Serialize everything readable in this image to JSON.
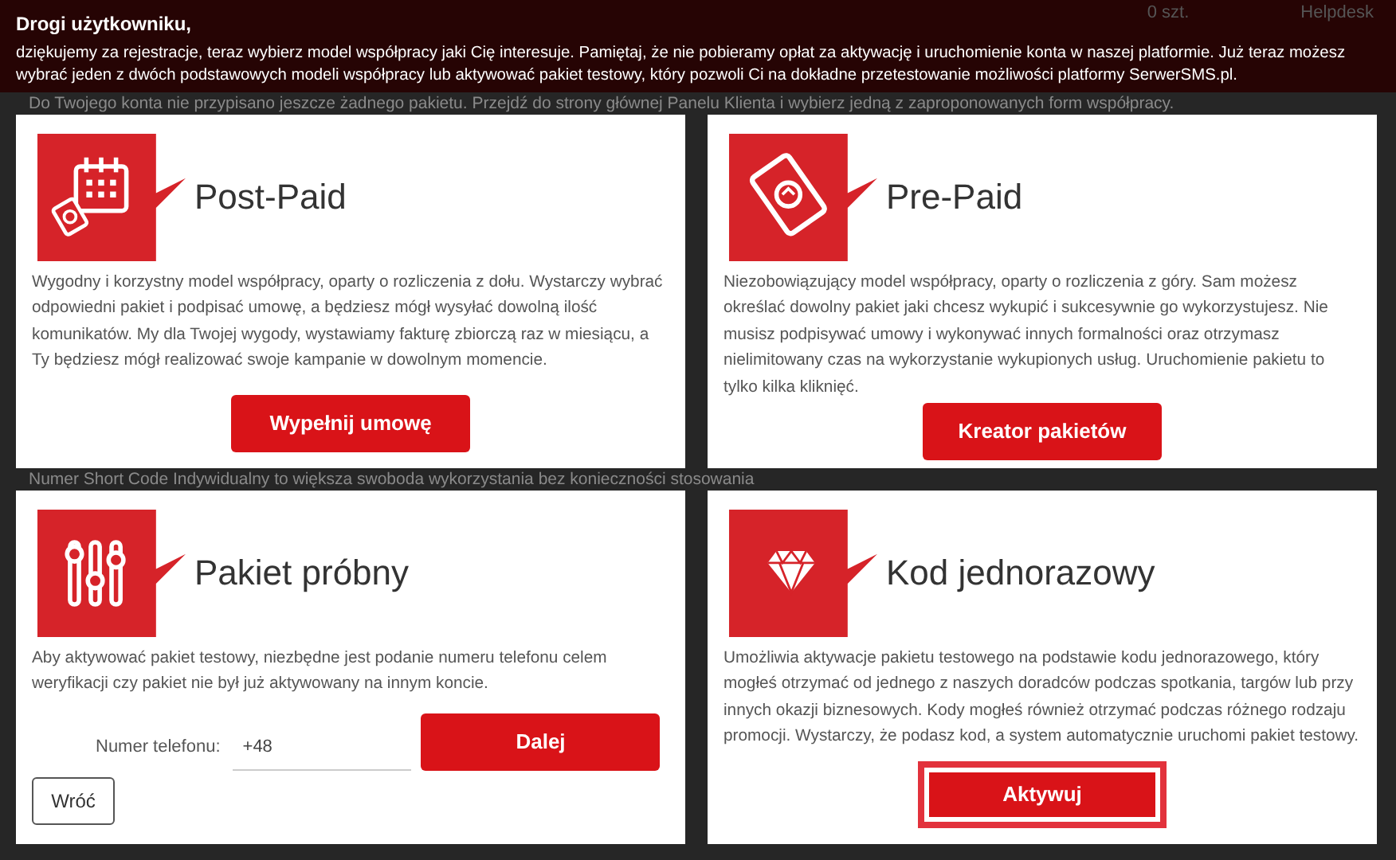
{
  "header": {
    "items": [
      "0 szt.",
      "Helpdesk"
    ]
  },
  "intro": {
    "greeting": "Drogi użytkowniku,",
    "text": "dziękujemy za rejestracje, teraz wybierz model współpracy jaki Cię interesuje. Pamiętaj, że nie pobieramy opłat za aktywację i uruchomienie konta w naszej platformie. Już teraz możesz wybrać jeden z dwóch podstawowych modeli współpracy lub aktywować pakiet testowy, który pozwoli Ci na dokładne przetestowanie możliwości platformy SerwerSMS.pl."
  },
  "background_lines": [
    "Do Twojego konta nie przypisano jeszcze żadnego pakietu. Przejdź do strony głównej Panelu Klienta i wybierz jedną z zaproponowanych form współpracy.",
    "Numer Short Code Indywidualny to większa swoboda wykorzystania bez konieczności stosowania"
  ],
  "cards": [
    {
      "kind": "action",
      "title": "Post-Paid",
      "description": "Wygodny i korzystny model współpracy, oparty o rozliczenia z dołu. Wystarczy wybrać odpowiedni pakiet i podpisać umowę, a będziesz mógł wysyłać dowolną ilość komunikatów. My dla Twojej wygody, wystawiamy fakturę zbiorczą raz w miesiącu, a Ty będziesz mógł realizować swoje kampanie w dowolnym momencie.",
      "button": {
        "label": "Wypełnij umowę",
        "focused": false
      }
    },
    {
      "kind": "action",
      "title": "Pre-Paid",
      "description": "Niezobowiązujący model współpracy, oparty o rozliczenia z góry. Sam możesz określać dowolny pakiet jaki chcesz wykupić i sukcesywnie go wykorzystujesz. Nie musisz podpisywać umowy i wykonywać innych formalności oraz otrzymasz nielimitowany czas na wykorzystanie wykupionych usług. Uruchomienie pakietu to tylko kilka kliknięć.",
      "button": {
        "label": "Kreator pakietów",
        "focused": false
      }
    },
    {
      "kind": "phone",
      "title": "Pakiet próbny",
      "description": "Aby aktywować pakiet testowy, niezbędne jest podanie numeru telefonu celem weryfikacji czy pakiet nie był już aktywowany na innym koncie.",
      "field_label": "Numer telefonu:",
      "field_value": "+48",
      "button": {
        "label": "Dalej",
        "focused": false
      },
      "back_button": "Wróć"
    },
    {
      "kind": "action",
      "title": "Kod jednorazowy",
      "description": "Umożliwia aktywacje pakietu testowego na podstawie kodu jednorazowego, który mogłeś otrzymać od jednego z naszych doradców podczas spotkania, targów lub przy innych okazji biznesowych. Kody mogłeś również otrzymać podczas różnego rodzaju promocji. Wystarczy, że podasz kod, a system automatycznie uruchomi pakiet testowy.",
      "button": {
        "label": "Aktywuj",
        "focused": true
      }
    }
  ]
}
